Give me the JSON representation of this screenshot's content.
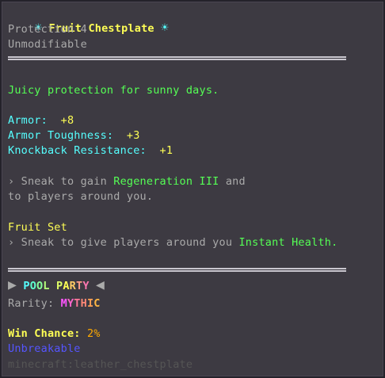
{
  "tooltip": {
    "name": "Fruit Chestplate",
    "enchant": "Protection 4",
    "modifier": "Unmodifiable",
    "lore": "Juicy protection for sunny days.",
    "stats": [
      {
        "label": "Armor: ",
        "value": "+8"
      },
      {
        "label": "Armor Toughness: ",
        "value": "+3"
      },
      {
        "label": "Knockback Resistance: ",
        "value": "+1"
      }
    ],
    "ability": {
      "prefix": "› Sneak to gain ",
      "effect": "Regeneration III",
      "suffix": " and",
      "line2": "to players around you."
    },
    "set": {
      "name": "Fruit Set",
      "prefix": "› Sneak to give players around you ",
      "effect": "Instant Health."
    },
    "pool_party": "POOL PARTY",
    "pool_party_colors": [
      "#55ffff",
      "#5fffd0",
      "#88ff9c",
      "#b6ff7a",
      "#e0ff66",
      "#ffff55",
      "#ffcc66",
      "#ff9e88",
      "#ff77b0",
      "#f066e8"
    ],
    "rarity_label": "Rarity: ",
    "rarity_value": "MYTHIC",
    "rarity_colors": [
      "#ff55ff",
      "#ff66cc",
      "#ff7799",
      "#ff8877",
      "#ffa055",
      "#ffb844"
    ],
    "win_chance_label": "Win Chance: ",
    "win_chance_value": "2%",
    "unbreakable": "Unbreakable",
    "item_id": "minecraft:leather_chestplate"
  }
}
